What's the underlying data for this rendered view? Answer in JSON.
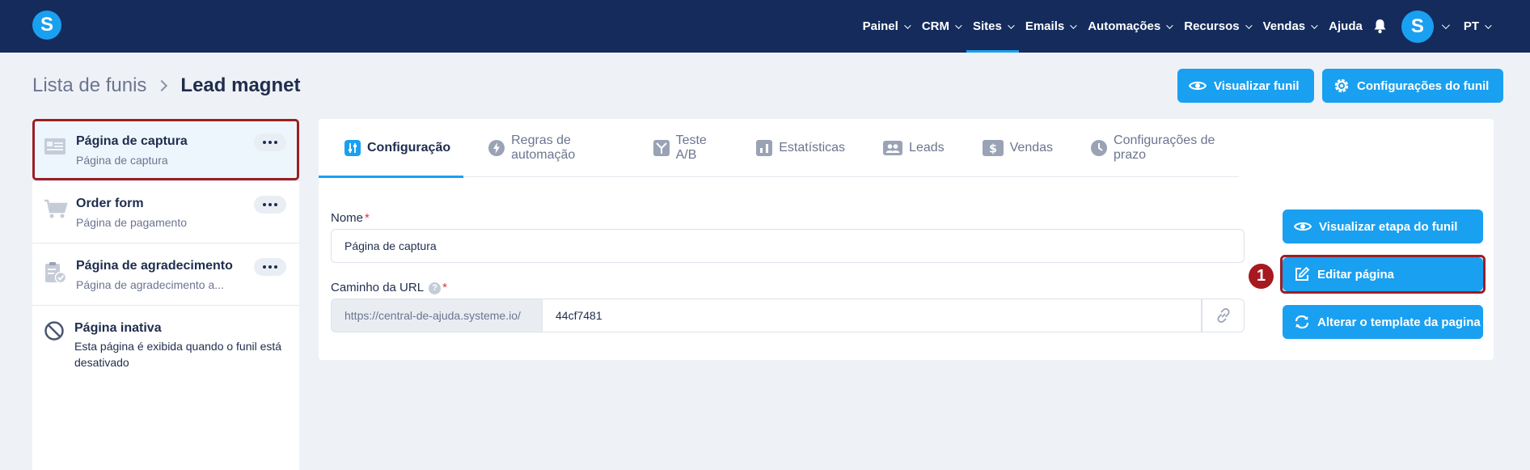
{
  "nav": {
    "logo": "S",
    "items": [
      {
        "label": "Painel",
        "active": false
      },
      {
        "label": "CRM",
        "active": false
      },
      {
        "label": "Sites",
        "active": true
      },
      {
        "label": "Emails",
        "active": false
      },
      {
        "label": "Automações",
        "active": false
      },
      {
        "label": "Recursos",
        "active": false
      },
      {
        "label": "Vendas",
        "active": false
      }
    ],
    "help": "Ajuda",
    "notifications_icon": "bell-icon",
    "avatar": "S",
    "language": "PT"
  },
  "breadcrumb": {
    "parent": "Lista de funis",
    "current": "Lead magnet"
  },
  "header_buttons": {
    "preview_funnel": "Visualizar funil",
    "funnel_settings": "Configurações do funil"
  },
  "sidebar": {
    "steps": [
      {
        "title": "Página de captura",
        "subtitle": "Página de captura",
        "icon": "squeeze-page-icon",
        "selected": true
      },
      {
        "title": "Order form",
        "subtitle": "Página de pagamento",
        "icon": "cart-icon",
        "selected": false
      },
      {
        "title": "Página de agradecimento",
        "subtitle": "Página de agradecimento a...",
        "icon": "clipboard-check-icon",
        "selected": false
      }
    ],
    "inactive": {
      "title": "Página inativa",
      "description": "Esta página é exibida quando o funil está desativado",
      "icon": "prohibited-icon"
    }
  },
  "tabs": [
    {
      "label": "Configuração",
      "icon": "sliders-icon",
      "active": true
    },
    {
      "label": "Regras de automação",
      "icon": "bolt-icon",
      "active": false
    },
    {
      "label": "Teste A/B",
      "icon": "split-icon",
      "active": false
    },
    {
      "label": "Estatísticas",
      "icon": "bar-chart-icon",
      "active": false
    },
    {
      "label": "Leads",
      "icon": "users-icon",
      "active": false
    },
    {
      "label": "Vendas",
      "icon": "dollar-icon",
      "active": false
    },
    {
      "label": "Configurações de prazo",
      "icon": "clock-icon",
      "active": false
    }
  ],
  "form": {
    "name_label": "Nome",
    "name_value": "Página de captura",
    "url_label": "Caminho da URL",
    "help_glyph": "?",
    "required_mark": "*",
    "url_prefix": "https://central-de-ajuda.systeme.io/",
    "url_value": "44cf7481"
  },
  "actions": {
    "preview_step": "Visualizar etapa do funil",
    "edit_page": "Editar página",
    "change_template": "Alterar o template da pagina"
  },
  "annotation": {
    "step_number": "1"
  },
  "colors": {
    "nav_bg": "#142b5c",
    "accent": "#1aa0f0",
    "highlight": "#9b1f24"
  }
}
